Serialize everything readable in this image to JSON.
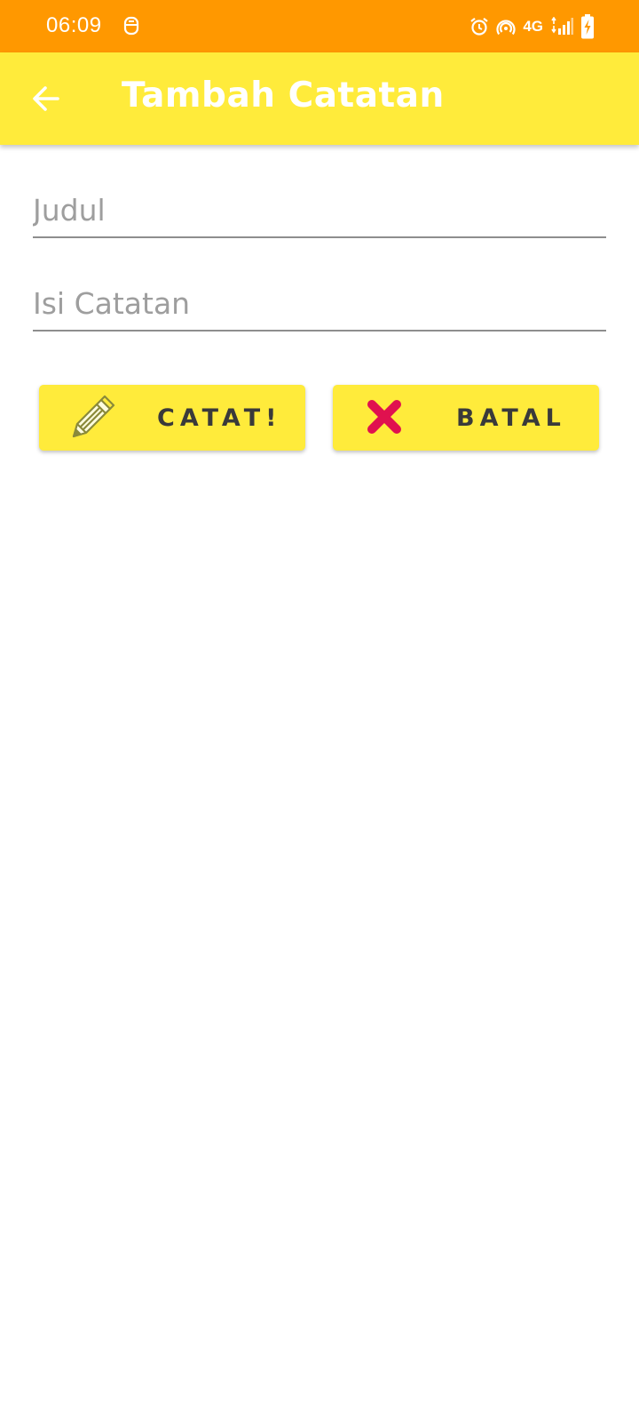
{
  "status_bar": {
    "time": "06:09",
    "network": "4G",
    "icons": [
      "notification-icon",
      "alarm-icon",
      "hotspot-icon",
      "signal-icon",
      "battery-charging-icon"
    ]
  },
  "app_bar": {
    "title": "Tambah Catatan",
    "back_icon": "arrow-back-icon",
    "color": "#ffeb3b"
  },
  "form": {
    "title_placeholder": "Judul",
    "title_value": "",
    "content_placeholder": "Isi Catatan",
    "content_value": ""
  },
  "buttons": {
    "save_label": "CATAT!",
    "save_icon": "pencil-icon",
    "cancel_label": "BATAL",
    "cancel_icon": "close-x-icon"
  },
  "colors": {
    "status_bar": "#ff9800",
    "app_bar": "#ffeb3b",
    "button": "#ffeb3b",
    "cancel_icon": "#e0114f"
  }
}
